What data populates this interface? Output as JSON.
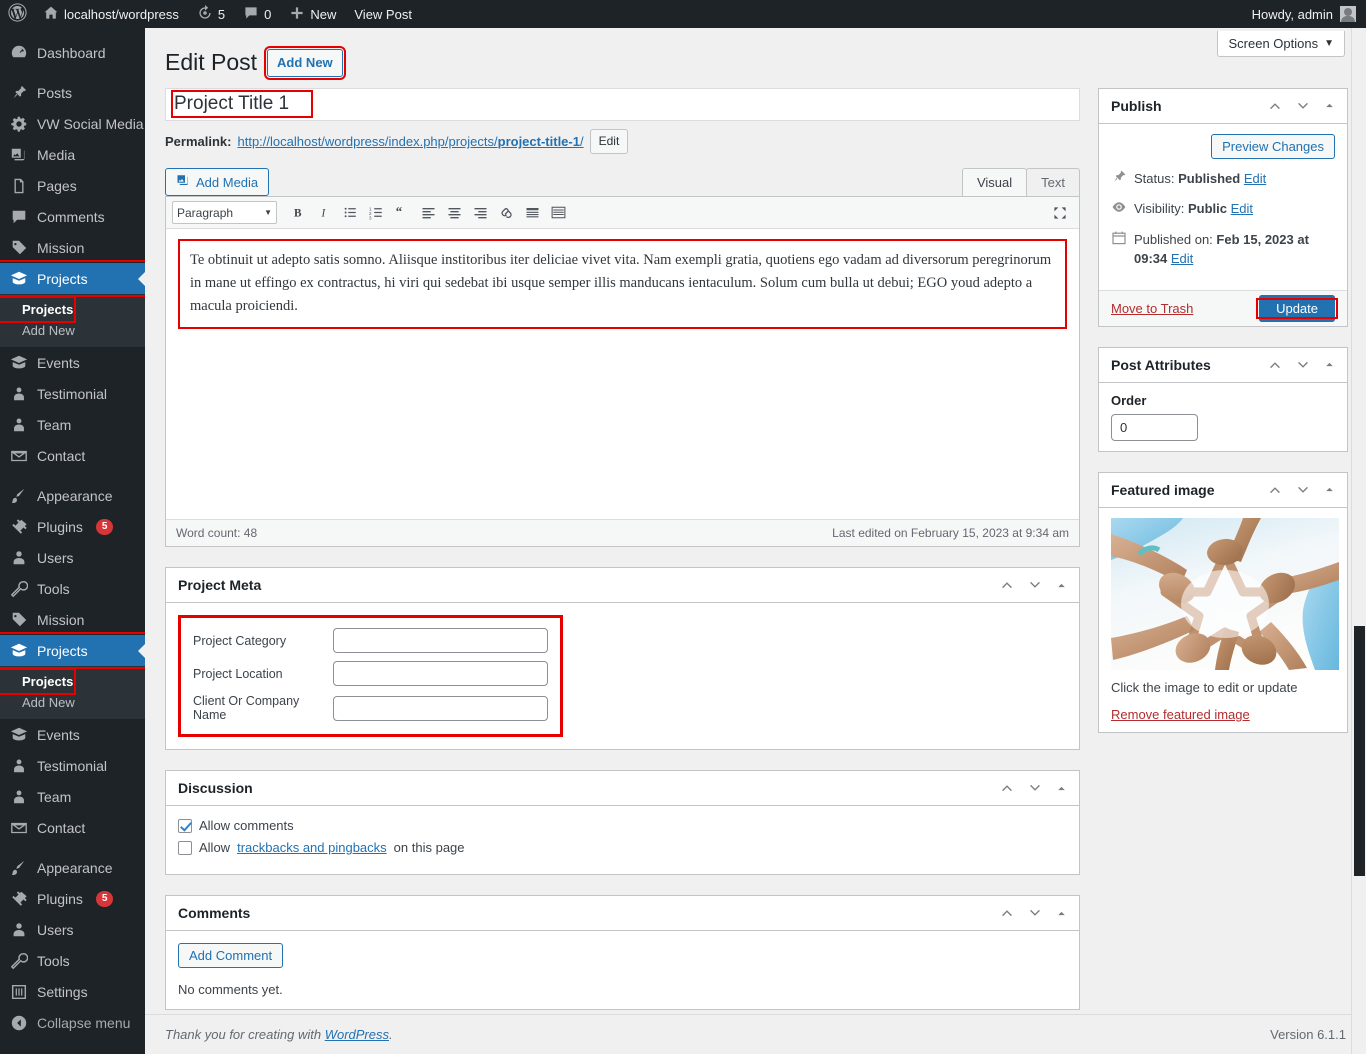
{
  "adminbar": {
    "logo_icon": "wordpress-logo-icon",
    "site_name": "localhost/wordpress",
    "home_icon": "home-icon",
    "updates_icon": "updates-icon",
    "updates_count": "5",
    "comments_icon": "comment-bubble-icon",
    "comments_count": "0",
    "new_icon": "plus-icon",
    "new_label": "New",
    "view_post_label": "View Post",
    "howdy": "Howdy, admin",
    "avatar_icon": "user-avatar-icon"
  },
  "sidebar": {
    "groups": [
      {
        "items": [
          {
            "label": "Dashboard",
            "icon": "dashboard-icon"
          }
        ]
      },
      {
        "items": [
          {
            "label": "Posts",
            "icon": "pin-icon"
          },
          {
            "label": "VW Social Media",
            "icon": "gear-icon"
          },
          {
            "label": "Media",
            "icon": "media-icon"
          },
          {
            "label": "Pages",
            "icon": "pages-icon"
          },
          {
            "label": "Comments",
            "icon": "comment-bubble-icon"
          },
          {
            "label": "Mission",
            "icon": "tag-icon"
          },
          {
            "label": "Projects",
            "icon": "portfolio-icon",
            "current": true,
            "submenu": [
              {
                "label": "Projects",
                "current": true
              },
              {
                "label": "Add New"
              }
            ]
          },
          {
            "label": "Events",
            "icon": "portfolio-icon"
          },
          {
            "label": "Testimonial",
            "icon": "person-icon"
          },
          {
            "label": "Team",
            "icon": "person-icon"
          },
          {
            "label": "Contact",
            "icon": "envelope-icon"
          }
        ]
      },
      {
        "items": [
          {
            "label": "Appearance",
            "icon": "brush-icon"
          },
          {
            "label": "Plugins",
            "icon": "plugin-icon",
            "badge": "5"
          },
          {
            "label": "Users",
            "icon": "user-icon"
          },
          {
            "label": "Tools",
            "icon": "wrench-icon"
          },
          {
            "label": "Mission",
            "icon": "tag-icon"
          },
          {
            "label": "Projects",
            "icon": "portfolio-icon",
            "current": true,
            "submenu": [
              {
                "label": "Projects",
                "current": true
              },
              {
                "label": "Add New"
              }
            ]
          },
          {
            "label": "Events",
            "icon": "portfolio-icon"
          },
          {
            "label": "Testimonial",
            "icon": "person-icon"
          },
          {
            "label": "Team",
            "icon": "person-icon"
          },
          {
            "label": "Contact",
            "icon": "envelope-icon"
          }
        ]
      },
      {
        "items": [
          {
            "label": "Appearance",
            "icon": "brush-icon"
          },
          {
            "label": "Plugins",
            "icon": "plugin-icon",
            "badge": "5"
          },
          {
            "label": "Users",
            "icon": "user-icon"
          },
          {
            "label": "Tools",
            "icon": "wrench-icon"
          },
          {
            "label": "Settings",
            "icon": "settings-icon"
          }
        ]
      }
    ],
    "collapse_label": "Collapse menu",
    "collapse_icon": "collapse-arrow-icon"
  },
  "screen_options": {
    "label": "Screen Options",
    "caret": "▼"
  },
  "page": {
    "title": "Edit Post",
    "add_new_label": "Add New"
  },
  "post": {
    "title_value": "Project Title 1",
    "permalink_label": "Permalink:",
    "permalink_base": "http://localhost/wordpress/index.php/projects/",
    "permalink_slug": "project-title-1",
    "permalink_tail": "/",
    "permalink_edit_label": "Edit"
  },
  "editor": {
    "add_media_label": "Add Media",
    "add_media_icon": "media-icon",
    "tabs": [
      {
        "label": "Visual",
        "active": true
      },
      {
        "label": "Text",
        "active": false
      }
    ],
    "format_select": "Paragraph",
    "toolbar_icons": [
      "bold-icon",
      "italic-icon",
      "bulleted-list-icon",
      "numbered-list-icon",
      "blockquote-icon",
      "align-left-icon",
      "align-center-icon",
      "align-right-icon",
      "link-icon",
      "read-more-icon",
      "toolbar-toggle-icon"
    ],
    "fullscreen_icon": "fullscreen-icon",
    "content": "Te obtinuit ut adepto satis somno. Aliisque institoribus iter deliciae vivet vita. Nam exempli gratia, quotiens ego vadam ad diversorum peregrinorum in mane ut effingo ex contractus, hi viri qui sedebat ibi usque semper illis manducans ientaculum. Solum cum bulla ut debui; EGO youd adepto a macula proiciendi.",
    "word_count": "Word count: 48",
    "last_edited": "Last edited on February 15, 2023 at 9:34 am"
  },
  "project_meta": {
    "title": "Project Meta",
    "fields": [
      {
        "label": "Project Category",
        "value": ""
      },
      {
        "label": "Project Location",
        "value": ""
      },
      {
        "label": "Client Or Company Name",
        "value": ""
      }
    ]
  },
  "discussion": {
    "title": "Discussion",
    "allow_comments_label": "Allow comments",
    "allow_comments_checked": true,
    "trackbacks_prefix": "Allow",
    "trackbacks_link": "trackbacks and pingbacks",
    "trackbacks_suffix": "on this page",
    "trackbacks_checked": false
  },
  "comments": {
    "title": "Comments",
    "add_comment_label": "Add Comment",
    "empty_text": "No comments yet."
  },
  "publish": {
    "title": "Publish",
    "preview_label": "Preview Changes",
    "status_icon": "pin-icon",
    "status_label": "Status:",
    "status_value": "Published",
    "status_edit": "Edit",
    "visibility_icon": "eye-icon",
    "visibility_label": "Visibility:",
    "visibility_value": "Public",
    "visibility_edit": "Edit",
    "published_icon": "calendar-icon",
    "published_label": "Published on:",
    "published_value": "Feb 15, 2023 at 09:34",
    "published_edit": "Edit",
    "trash_label": "Move to Trash",
    "update_label": "Update"
  },
  "post_attributes": {
    "title": "Post Attributes",
    "order_label": "Order",
    "order_value": "0"
  },
  "featured_image": {
    "title": "Featured image",
    "caption": "Click the image to edit or update",
    "remove_label": "Remove featured image",
    "image_alt": "hands-forming-star-photo"
  },
  "footer": {
    "thanks_prefix": "Thank you for creating with",
    "wordpress_link": "WordPress",
    "thanks_suffix": ".",
    "version": "Version 6.1.1"
  },
  "handles": {
    "up": "move-up-icon",
    "down": "move-down-icon",
    "toggle": "toggle-panel-icon"
  }
}
